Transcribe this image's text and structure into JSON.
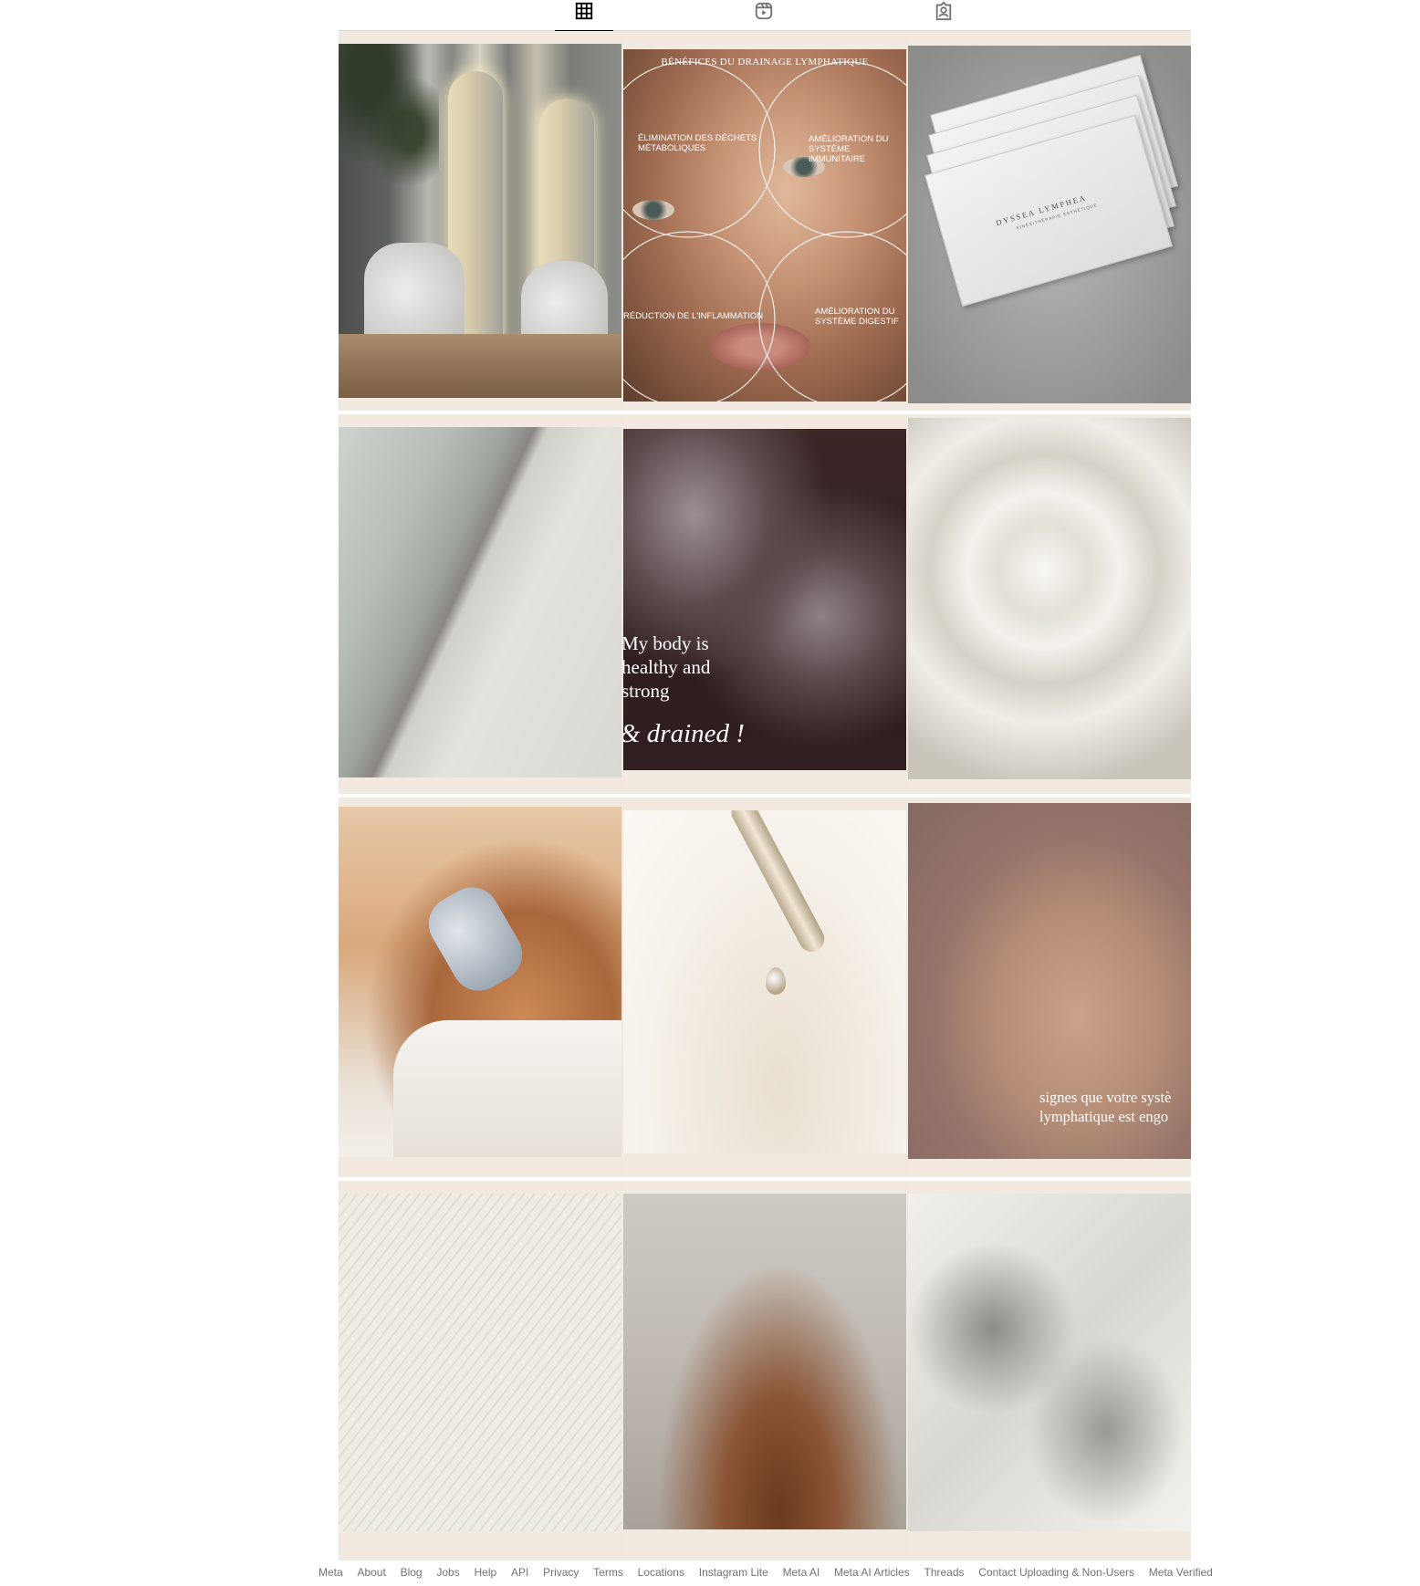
{
  "tabs": [
    {
      "name": "posts",
      "icon": "grid-icon",
      "active": true
    },
    {
      "name": "reels",
      "icon": "reels-icon",
      "active": false
    },
    {
      "name": "tagged",
      "icon": "tagged-icon",
      "active": false
    }
  ],
  "posts": {
    "infographic": {
      "title": "BÉNÉFICES DU DRAINAGE LYMPHATIQUE",
      "label_top_left": "ÉLIMINATION DES DÉCHETS MÉTABOLIQUES",
      "label_top_right": "AMÉLIORATION  DU SYSTÈME IMMUNITAIRE",
      "label_bottom_left": "RÉDUCTION DE L'INFLAMMATION",
      "label_bottom_right": "AMÉLIORATION DU SYSTÈME DIGESTIF"
    },
    "business_card": {
      "brand": "DYSSEA LYMPHEA",
      "subtitle": "KINÉSITHÉRAPIE ESTHÉTIQUE"
    },
    "affirmation": {
      "line1": "My body is",
      "line2": "healthy and",
      "line3": "strong",
      "line4": "& drained !"
    },
    "signs": {
      "line1": "signes que votre systè",
      "line2": "lymphatique est engo"
    }
  },
  "footer": {
    "links": [
      "Meta",
      "About",
      "Blog",
      "Jobs",
      "Help",
      "API",
      "Privacy",
      "Terms",
      "Locations",
      "Instagram Lite",
      "Meta AI",
      "Meta AI Articles",
      "Threads",
      "Contact Uploading & Non-Users",
      "Meta Verified"
    ]
  }
}
